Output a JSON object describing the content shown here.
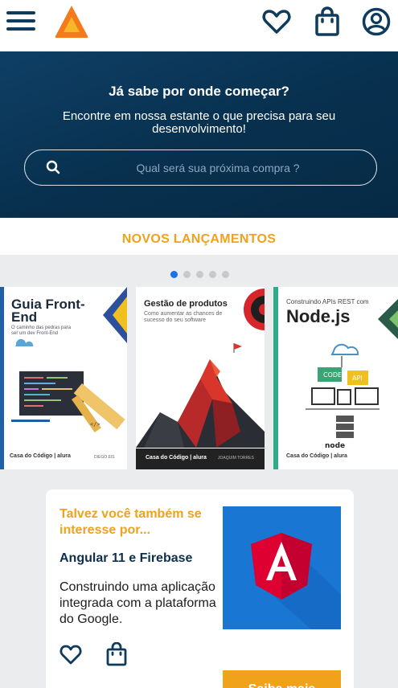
{
  "header": {
    "menu_icon": "hamburger-menu-icon",
    "logo_icon": "triangle-logo-icon",
    "icons": [
      "heart-icon",
      "shopping-bag-icon",
      "user-account-icon"
    ]
  },
  "hero": {
    "title": "Já sabe por onde começar?",
    "subtitle": "Encontre em nossa estante o que precisa para seu desenvolvimento!",
    "search_placeholder": "Qual será sua próxima compra ?",
    "search_icon": "search-icon"
  },
  "section": {
    "title": "NOVOS LANÇAMENTOS",
    "carousel": {
      "total_pages": 5,
      "current_page": 1
    }
  },
  "books": [
    {
      "title": "Guia Front-End",
      "subtitle": "O caminho das pedras para ser um dev Front-End",
      "author": "DIEGO EIS",
      "publisher": "Casa do Código | alura"
    },
    {
      "title": "Gestão de produtos",
      "subtitle": "Como aumentar as chances de sucesso do seu software",
      "author": "JOAQUIM TORRES",
      "publisher": "Casa do Código | alura"
    },
    {
      "title_pre": "Construindo APIs REST com",
      "title": "Node.js",
      "publisher": "Casa do Código | alura"
    }
  ],
  "suggestion": {
    "kicker": "Talvez você também se interesse por...",
    "title": "Angular 11 e Firebase",
    "description": "Construindo uma aplicação integrada com a plataforma do Google.",
    "button": "Saiba mais",
    "icons": [
      "heart-icon",
      "shopping-bag-icon"
    ]
  },
  "colors": {
    "brand_navy": "#0f3b5c",
    "accent_orange": "#f0a21a",
    "angular_red": "#dd0031"
  }
}
